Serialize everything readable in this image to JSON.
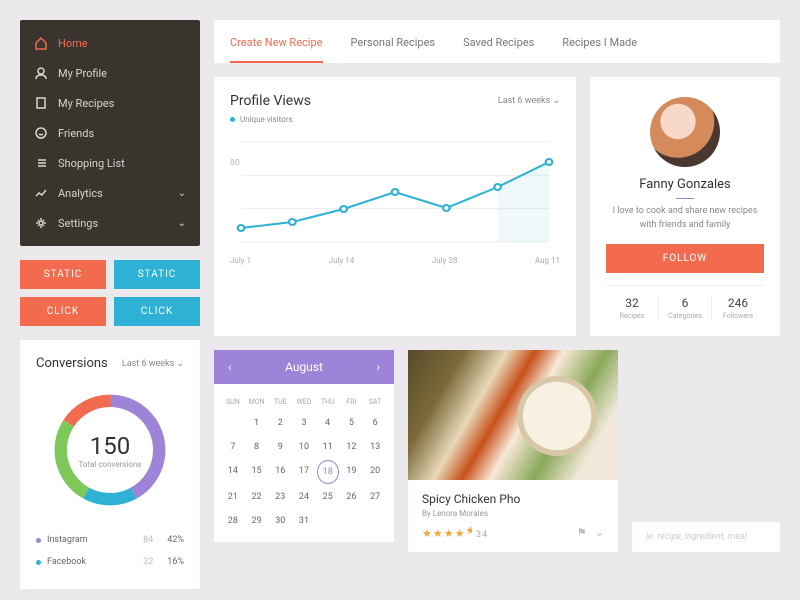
{
  "sidebar": {
    "items": [
      {
        "label": "Home",
        "icon": "home",
        "active": true
      },
      {
        "label": "My Profile",
        "icon": "user"
      },
      {
        "label": "My Recipes",
        "icon": "book"
      },
      {
        "label": "Friends",
        "icon": "smile"
      },
      {
        "label": "Shopping List",
        "icon": "list"
      },
      {
        "label": "Analytics",
        "icon": "chart",
        "expand": true
      },
      {
        "label": "Settings",
        "icon": "gear",
        "expand": true
      }
    ]
  },
  "buttons": {
    "static_orange": "STATIC",
    "static_blue": "STATIC",
    "click_orange": "CLICK",
    "click_blue": "CLICK"
  },
  "tabs": [
    {
      "label": "Create New Recipe",
      "active": true
    },
    {
      "label": "Personal Recipes"
    },
    {
      "label": "Saved Recipes"
    },
    {
      "label": "Recipes I Made"
    }
  ],
  "profile_views": {
    "title": "Profile Views",
    "range": "Last 6 weeks",
    "legend": "Unique visitors",
    "legend_color": "#2eb1d4",
    "x_labels": [
      "July 1",
      "July 14",
      "July 28",
      "Aug 11"
    ]
  },
  "chart_data": {
    "type": "line",
    "title": "Profile Views",
    "legend": [
      "Unique visitors"
    ],
    "x": [
      "July 1",
      "",
      "July 14",
      "",
      "July 28",
      "",
      "Aug 11"
    ],
    "ylim": [
      0,
      100
    ],
    "y_ticks": [
      80
    ],
    "series": [
      {
        "name": "Unique visitors",
        "values": [
          14,
          20,
          33,
          50,
          34,
          55,
          80
        ]
      }
    ]
  },
  "profile": {
    "name": "Fanny Gonzales",
    "bio": "I love to cook and share new recipes with friends and family",
    "follow": "FOLLOW",
    "stats": [
      {
        "n": "32",
        "l": "Recipes"
      },
      {
        "n": "6",
        "l": "Categories"
      },
      {
        "n": "246",
        "l": "Followers"
      }
    ]
  },
  "conversions": {
    "title": "Conversions",
    "range": "Last 6 weeks",
    "total": "150",
    "total_label": "Total conversions",
    "segments": [
      {
        "color": "#9d84d8",
        "pct": 42
      },
      {
        "color": "#2eb1d4",
        "pct": 16
      },
      {
        "color": "#7cc95a",
        "pct": 26
      },
      {
        "color": "#f26b4e",
        "pct": 16
      }
    ],
    "rows": [
      {
        "color": "#9d84d8",
        "name": "Instagram",
        "val": "84",
        "pct": "42%"
      },
      {
        "color": "#2eb1d4",
        "name": "Facebook",
        "val": "32",
        "pct": "16%"
      }
    ]
  },
  "calendar": {
    "month": "August",
    "dow": [
      "SUN",
      "MON",
      "TUE",
      "WED",
      "THU",
      "FRI",
      "SAT"
    ],
    "rows": [
      [
        "",
        "1",
        "2",
        "3",
        "4",
        "5",
        "6"
      ],
      [
        "7",
        "8",
        "9",
        "10",
        "11",
        "12",
        "13"
      ],
      [
        "14",
        "15",
        "16",
        "17",
        "18",
        "19",
        "20"
      ],
      [
        "21",
        "22",
        "23",
        "24",
        "25",
        "26",
        "27"
      ],
      [
        "28",
        "29",
        "30",
        "31",
        "",
        "",
        ""
      ]
    ],
    "selected": "18"
  },
  "recipe": {
    "title": "Spicy Chicken Pho",
    "by": "By Lenora Morales",
    "rating_count": "34"
  },
  "search": {
    "placeholder": "ie. recipe, ingredient, meal"
  }
}
